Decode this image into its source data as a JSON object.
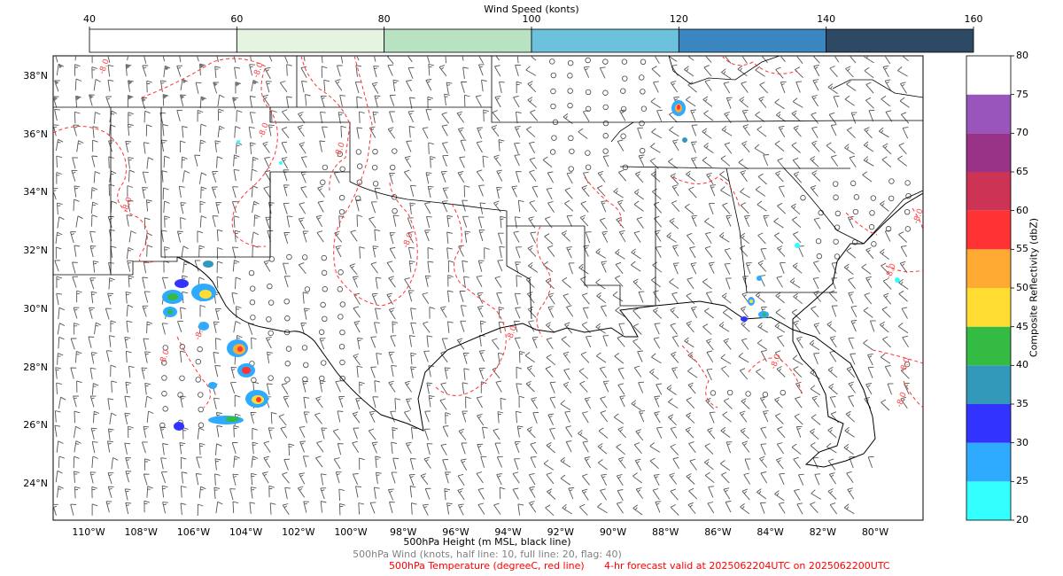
{
  "top_colorbar": {
    "title": "Wind Speed (konts)",
    "ticks": [
      "40",
      "60",
      "80",
      "100",
      "120",
      "140",
      "160"
    ],
    "colors": [
      "#ffffff",
      "#e4f4e0",
      "#b8e2c2",
      "#6cc1dd",
      "#3a86c1",
      "#2e4963"
    ]
  },
  "right_colorbar": {
    "title": "Composite Reflectivity (dbZ)",
    "ticks": [
      "20",
      "25",
      "30",
      "35",
      "40",
      "45",
      "50",
      "55",
      "60",
      "65",
      "70",
      "75",
      "80"
    ],
    "colors": [
      "#33ffff",
      "#2eaaff",
      "#3333ff",
      "#3399bb",
      "#33bb44",
      "#ffdd33",
      "#ffaa33",
      "#ff3333",
      "#cc3355",
      "#993388",
      "#9955bb",
      "#ffffff"
    ]
  },
  "map": {
    "lat_labels": [
      "38°N",
      "36°N",
      "34°N",
      "32°N",
      "30°N",
      "28°N",
      "26°N",
      "24°N"
    ],
    "lon_labels": [
      "110°W",
      "108°W",
      "106°W",
      "104°W",
      "102°W",
      "100°W",
      "98°W",
      "96°W",
      "94°W",
      "92°W",
      "90°W",
      "88°W",
      "86°W",
      "84°W",
      "82°W",
      "80°W"
    ],
    "contour_labels": [
      "-8.0",
      "-8.0",
      "-8.0",
      "-8.0",
      "-8.0",
      "-8.0",
      "-8.0",
      "-8.0",
      "-8.0",
      "-8.0",
      "-8.0",
      "-8.0",
      "-8.0",
      "-8.0"
    ],
    "colors": {
      "coast": "#000000",
      "temperature": "#ff0000",
      "barb": "#555555",
      "calm": "#444444"
    }
  },
  "footer": {
    "height_label": "500hPa Height (m MSL, black line)",
    "wind_label": "500hPa Wind (knots, half line: 10, full line: 20, flag: 40)",
    "temp_label": "500hPa Temperature (degreeC, red line)",
    "forecast_label": "4-hr forecast valid at 2025062204UTC on 2025062200UTC",
    "colors": {
      "height": "#000000",
      "wind": "#808080",
      "temp": "#ff0000"
    }
  }
}
